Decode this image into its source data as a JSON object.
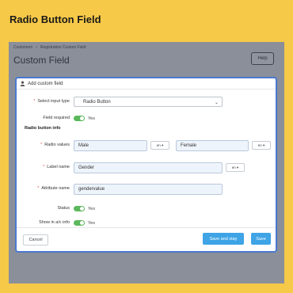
{
  "banner": {
    "title": "Radio Button Field"
  },
  "header": {
    "breadcrumb": [
      "Customers",
      "Registration Custom Field"
    ],
    "title": "Custom Field",
    "help_label": "Help"
  },
  "modal": {
    "title": "Add custom field",
    "fields": {
      "input_type": {
        "label": "Select input type",
        "value": "Radio Button"
      },
      "field_required": {
        "label": "Field required",
        "value": "Yes"
      },
      "section_title": "Radio button info",
      "radio_values": {
        "label": "Radio values",
        "value1": "Male",
        "lang1": "en",
        "value2": "Female",
        "lang2": "en"
      },
      "label_name": {
        "label": "Label name",
        "value": "Gender",
        "lang": "en"
      },
      "attribute_name": {
        "label": "Attribute name",
        "value": "gendervalue"
      },
      "status": {
        "label": "Status",
        "value": "Yes"
      },
      "show_in_ac": {
        "label": "Show in a/c info",
        "value": "Yes"
      }
    },
    "footer": {
      "cancel_label": "Cancel",
      "save_stay_label": "Save and stay",
      "save_label": "Save"
    }
  },
  "colors": {
    "background": "#f7c948",
    "accent": "#3ea4e6",
    "toggle_on": "#5cb85c",
    "required": "#d9534f"
  }
}
